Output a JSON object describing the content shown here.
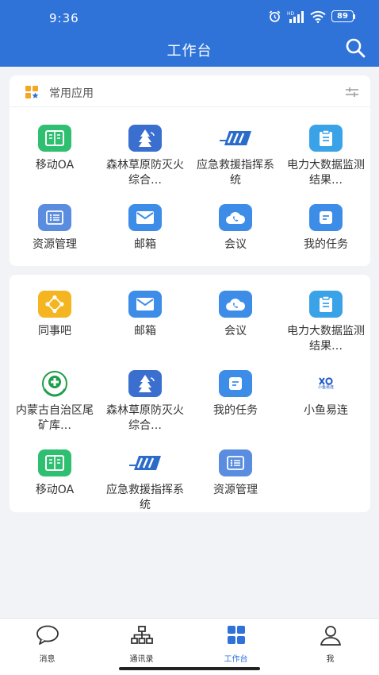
{
  "status": {
    "time": "9:36",
    "battery": "89",
    "icons": [
      "alarm-icon",
      "signal-icon",
      "wifi-icon",
      "battery-icon"
    ]
  },
  "header": {
    "title": "工作台",
    "search_icon": "search-icon"
  },
  "common_section": {
    "title": "常用应用",
    "apps": [
      {
        "label": "移动OA",
        "icon": "mobile-oa-icon"
      },
      {
        "label": "森林草原防灭火综合…",
        "icon": "forest-fire-icon"
      },
      {
        "label": "应急救援指挥系统",
        "icon": "emergency-command-icon"
      },
      {
        "label": "电力大数据监测结果…",
        "icon": "clipboard-icon"
      },
      {
        "label": "资源管理",
        "icon": "list-icon"
      },
      {
        "label": "邮箱",
        "icon": "mail-icon"
      },
      {
        "label": "会议",
        "icon": "cloud-phone-icon"
      },
      {
        "label": "我的任务",
        "icon": "task-icon"
      }
    ]
  },
  "all_section": {
    "apps": [
      {
        "label": "同事吧",
        "icon": "colleague-network-icon"
      },
      {
        "label": "邮箱",
        "icon": "mail-icon"
      },
      {
        "label": "会议",
        "icon": "cloud-phone-icon"
      },
      {
        "label": "电力大数据监测结果…",
        "icon": "clipboard-icon"
      },
      {
        "label": "内蒙古自治区尾矿库…",
        "icon": "safety-emblem-icon"
      },
      {
        "label": "森林草原防灭火综合…",
        "icon": "forest-fire-icon"
      },
      {
        "label": "我的任务",
        "icon": "task-icon"
      },
      {
        "label": "小鱼易连",
        "icon": "xiaoyu-logo-icon",
        "logo_text": "小鱼易连"
      },
      {
        "label": "移动OA",
        "icon": "mobile-oa-icon"
      },
      {
        "label": "应急救援指挥系统",
        "icon": "emergency-command-icon"
      },
      {
        "label": "资源管理",
        "icon": "list-icon"
      }
    ]
  },
  "tabbar": {
    "tabs": [
      {
        "label": "消息",
        "icon": "message-icon"
      },
      {
        "label": "通讯录",
        "icon": "org-chart-icon"
      },
      {
        "label": "工作台",
        "icon": "grid-icon",
        "active": true
      },
      {
        "label": "我",
        "icon": "user-icon"
      }
    ]
  },
  "colors": {
    "primary": "#2f73d9",
    "green": "#2fbf71",
    "orange": "#f5a623",
    "lightblue": "#3d8de8"
  }
}
